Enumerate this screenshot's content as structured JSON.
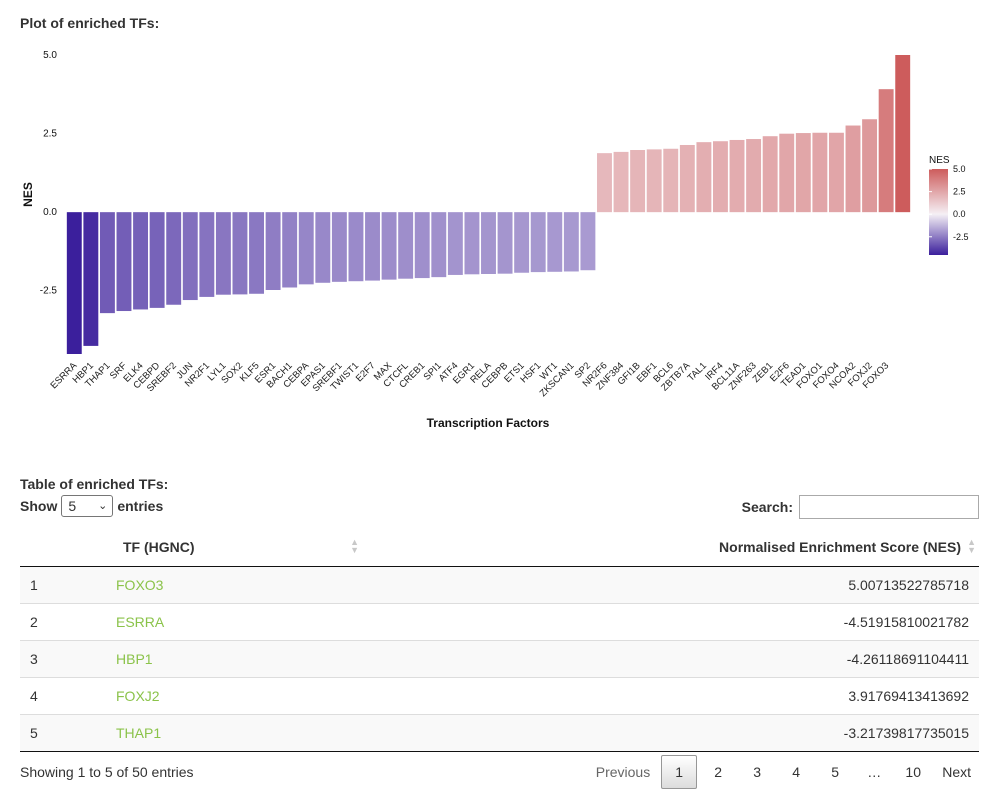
{
  "plot_title": "Plot of enriched TFs:",
  "table_title": "Table of enriched TFs:",
  "chart_data": {
    "type": "bar",
    "xlabel": "Transcription Factors",
    "ylabel": "NES",
    "ylim": [
      -4.519,
      5.007
    ],
    "yticks": [
      -2.5,
      0.0,
      2.5,
      5.0
    ],
    "ytick_labels": [
      "-2.5",
      "0.0",
      "2.5",
      "5.0"
    ],
    "legend": {
      "title": "NES",
      "position": "right",
      "ticks": [
        "5.0",
        "2.5",
        "0.0",
        "-2.5"
      ],
      "tick_values": [
        5.0,
        2.5,
        0.0,
        -2.5
      ]
    },
    "colors": {
      "low": "#3b1f9c",
      "mid": "#f5f0f5",
      "high": "#cd5c5c"
    },
    "categories": [
      "ESRRA",
      "HBP1",
      "THAP1",
      "SRF",
      "ELK4",
      "CEBPD",
      "SREBF2",
      "JUN",
      "NR2F1",
      "LYL1",
      "SOX2",
      "KLF5",
      "ESR1",
      "BACH1",
      "CEBPA",
      "EPAS1",
      "SREBF1",
      "TWIST1",
      "E2F7",
      "MAX",
      "CTCFL",
      "CREB1",
      "SPI1",
      "ATF4",
      "EGR1",
      "RELA",
      "CEBPB",
      "ETS1",
      "HSF1",
      "WT1",
      "ZKSCAN1",
      "SP2",
      "NR2F6",
      "ZNF384",
      "GFI1B",
      "EBF1",
      "BCL6",
      "ZBTB7A",
      "TAL1",
      "IRF4",
      "BCL11A",
      "ZNF263",
      "ZEB1",
      "E2F6",
      "TEAD1",
      "FOXO1",
      "FOXO4",
      "NCOA2",
      "FOXJ2",
      "FOXO3"
    ],
    "values": [
      -4.519,
      -4.261,
      -3.217,
      -3.15,
      -3.1,
      -3.05,
      -2.95,
      -2.8,
      -2.7,
      -2.63,
      -2.62,
      -2.6,
      -2.48,
      -2.4,
      -2.3,
      -2.25,
      -2.22,
      -2.2,
      -2.18,
      -2.15,
      -2.12,
      -2.1,
      -2.07,
      -2.0,
      -1.98,
      -1.97,
      -1.96,
      -1.93,
      -1.91,
      -1.9,
      -1.89,
      -1.85,
      1.88,
      1.92,
      1.98,
      2.0,
      2.02,
      2.14,
      2.23,
      2.26,
      2.3,
      2.33,
      2.42,
      2.5,
      2.52,
      2.53,
      2.53,
      2.76,
      2.96,
      3.918,
      5.007
    ]
  },
  "table": {
    "length_label_pre": "Show",
    "length_value": "5",
    "length_label_post": "entries",
    "search_label": "Search:",
    "columns": [
      "",
      "TF (HGNC)",
      "Normalised Enrichment Score (NES)"
    ],
    "rows": [
      {
        "idx": "1",
        "tf": "FOXO3",
        "nes": "5.00713522785718"
      },
      {
        "idx": "2",
        "tf": "ESRRA",
        "nes": "-4.51915810021782"
      },
      {
        "idx": "3",
        "tf": "HBP1",
        "nes": "-4.26118691104411"
      },
      {
        "idx": "4",
        "tf": "FOXJ2",
        "nes": "3.91769413413692"
      },
      {
        "idx": "5",
        "tf": "THAP1",
        "nes": "-3.21739817735015"
      }
    ],
    "info": "Showing 1 to 5 of 50 entries",
    "pagination": {
      "previous": "Previous",
      "pages": [
        "1",
        "2",
        "3",
        "4",
        "5",
        "…",
        "10"
      ],
      "current": "1",
      "next": "Next"
    }
  }
}
